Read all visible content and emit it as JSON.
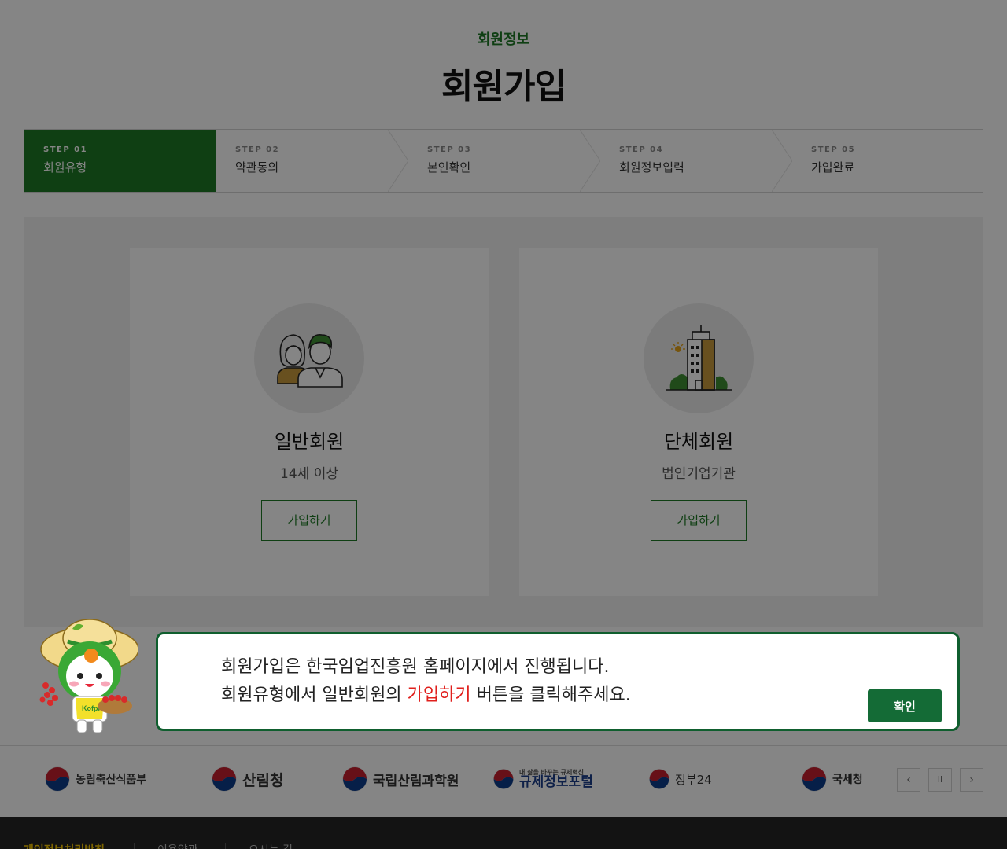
{
  "header": {
    "section": "회원정보",
    "title": "회원가입"
  },
  "steps": [
    {
      "no": "STEP 01",
      "label": "회원유형",
      "active": true
    },
    {
      "no": "STEP 02",
      "label": "약관동의",
      "active": false
    },
    {
      "no": "STEP 03",
      "label": "본인확인",
      "active": false
    },
    {
      "no": "STEP 04",
      "label": "회원정보입력",
      "active": false
    },
    {
      "no": "STEP 05",
      "label": "가입완료",
      "active": false
    }
  ],
  "cards": {
    "general": {
      "title": "일반회원",
      "sub": "14세 이상",
      "button": "가입하기",
      "icon": "people-icon"
    },
    "group": {
      "title": "단체회원",
      "sub": "법인기업기관",
      "button": "가입하기",
      "icon": "building-icon"
    }
  },
  "partners": [
    {
      "name": "농림축산식품부"
    },
    {
      "name": "산림청"
    },
    {
      "name": "국립산림과학원"
    },
    {
      "name": "규제정보포털",
      "tagline": "내 삶을 바꾸는 규제혁신"
    },
    {
      "name": "정부24"
    },
    {
      "name": "국세청"
    }
  ],
  "partner_controls": {
    "prev": "‹",
    "pause": "II",
    "next": "›"
  },
  "footer": {
    "links": [
      "개인정보처리방침",
      "이용약관",
      "오시는 길"
    ]
  },
  "dialog": {
    "line1": "회원가입은 한국임업진흥원 홈페이지에서 진행됩니다.",
    "line2_before": "회원유형에서 일반회원의 ",
    "line2_highlight": "가입하기",
    "line2_after": " 버튼을 클릭해주세요.",
    "confirm": "확인",
    "mascot_label": "Kofpi"
  },
  "colors": {
    "brand_green": "#1e7a25",
    "dialog_border": "#0f5e2e",
    "highlight_red": "#e0201d",
    "footer_bg": "#252525",
    "footer_highlight": "#f2c300"
  }
}
